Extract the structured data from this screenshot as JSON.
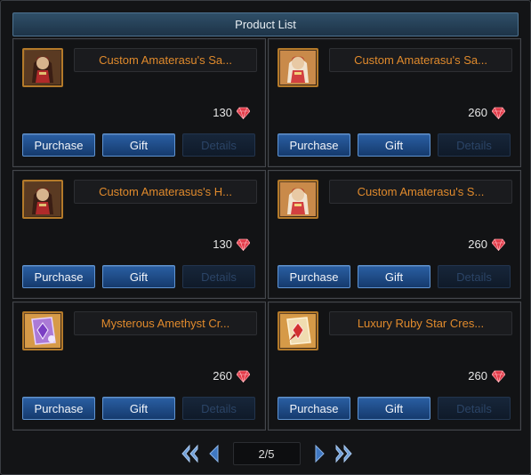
{
  "window": {
    "title": "Product List"
  },
  "products": [
    {
      "name": "Custom Amaterasu's Sa...",
      "price": "130",
      "icon": "costume-dark-icon",
      "purchase_label": "Purchase",
      "gift_label": "Gift",
      "details_label": "Details"
    },
    {
      "name": "Custom Amaterasu's Sa...",
      "price": "260",
      "icon": "costume-white-icon",
      "purchase_label": "Purchase",
      "gift_label": "Gift",
      "details_label": "Details"
    },
    {
      "name": "Custom Amaterasus's H...",
      "price": "130",
      "icon": "costume-dark-icon",
      "purchase_label": "Purchase",
      "gift_label": "Gift",
      "details_label": "Details"
    },
    {
      "name": "Custom Amaterasu's S...",
      "price": "260",
      "icon": "costume-white-icon",
      "purchase_label": "Purchase",
      "gift_label": "Gift",
      "details_label": "Details"
    },
    {
      "name": "Mysterous Amethyst Cr...",
      "price": "260",
      "icon": "amethyst-crest-icon",
      "purchase_label": "Purchase",
      "gift_label": "Gift",
      "details_label": "Details"
    },
    {
      "name": "Luxury Ruby Star Cres...",
      "price": "260",
      "icon": "ruby-crest-icon",
      "purchase_label": "Purchase",
      "gift_label": "Gift",
      "details_label": "Details"
    }
  ],
  "currency_icon": "ruby-gem-icon",
  "pagination": {
    "page_display": "2/5"
  },
  "colors": {
    "item_name": "#e08a2c",
    "button_active": "#2a5fa3",
    "button_disabled": "#17263a",
    "title_bar": "#2f4f68",
    "gem": "#e23a48"
  }
}
